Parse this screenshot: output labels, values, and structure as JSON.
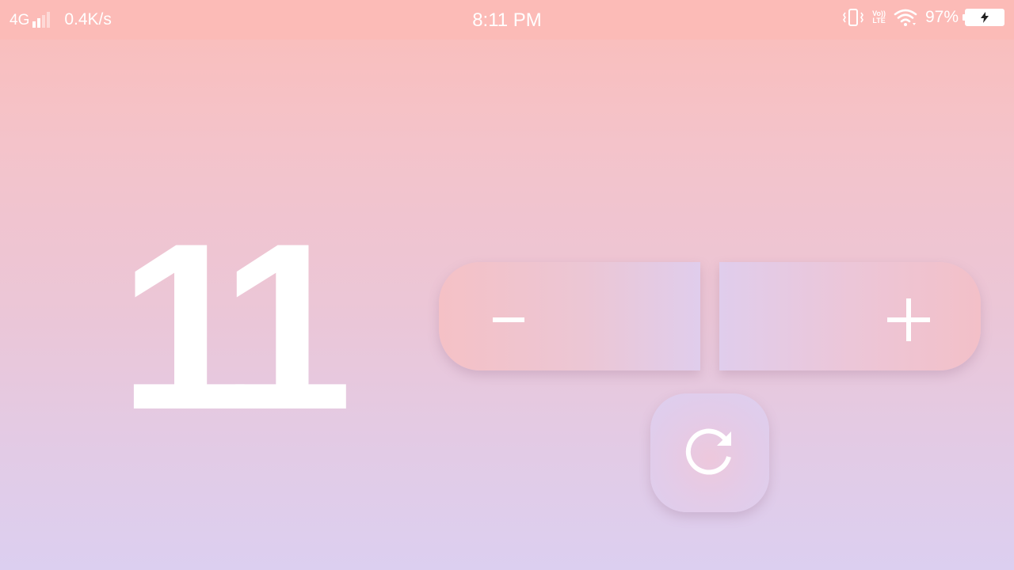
{
  "status_bar": {
    "network_type": "4G",
    "data_speed": "0.4K/s",
    "time": "8:11 PM",
    "volte_top": "Vo))",
    "volte_bottom": "LTE",
    "battery_percent": "97%",
    "battery_level": 0.97,
    "icons": [
      "signal-icon",
      "vibrate-icon",
      "volte-icon",
      "wifi-icon",
      "battery-charging-icon"
    ]
  },
  "counter": {
    "value": "11"
  },
  "controls": {
    "decrement_icon": "minus-icon",
    "increment_icon": "plus-icon",
    "reset_icon": "refresh-icon"
  },
  "colors": {
    "background_top": "#fbbdb9",
    "background_bottom": "#dccff0",
    "foreground": "#ffffff"
  }
}
